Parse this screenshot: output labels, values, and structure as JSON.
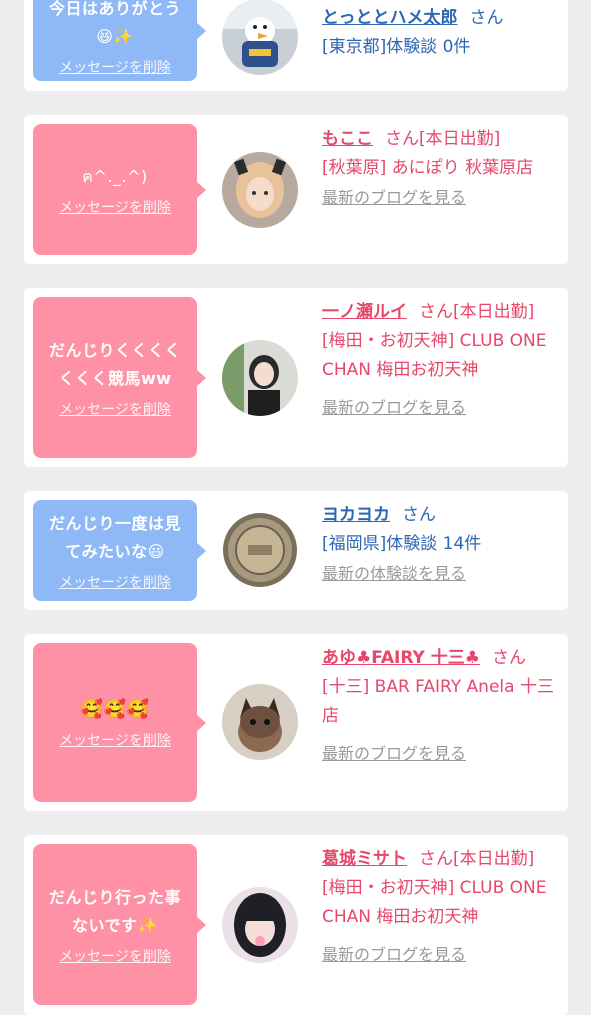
{
  "cards": [
    {
      "message": "今日はありがとう😆✨",
      "delete_label": "メッセージを削除",
      "name": "とっととハメ太郎",
      "honorific": "さん",
      "subtitle": "[東京都]体験談 0件",
      "link": ""
    },
    {
      "message": "ฅ^._.^)",
      "delete_label": "メッセージを削除",
      "name": "もここ",
      "honorific": "さん[本日出勤]",
      "subtitle": "[秋葉原] あにぽり 秋葉原店",
      "link": "最新のブログを見る"
    },
    {
      "message": "だんじりくくくくくくく競馬ww",
      "delete_label": "メッセージを削除",
      "name": "一ノ瀬ルイ",
      "honorific": "さん[本日出勤]",
      "subtitle": "[梅田・お初天神] CLUB ONE CHAN 梅田お初天神",
      "link": "最新のブログを見る"
    },
    {
      "message": "だんじり一度は見てみたいな😃",
      "delete_label": "メッセージを削除",
      "name": "ヨカヨカ",
      "honorific": "さん",
      "subtitle": "[福岡県]体験談 14件",
      "link": "最新の体験談を見る"
    },
    {
      "message": "🥰🥰🥰",
      "delete_label": "メッセージを削除",
      "name": "あゆ♣FAIRY 十三♣",
      "honorific": "さん",
      "subtitle": "[十三] BAR FAIRY Anela 十三店",
      "link": "最新のブログを見る"
    },
    {
      "message": "だんじり行った事ないです✨",
      "delete_label": "メッセージを削除",
      "name": "葛城ミサト",
      "honorific": "さん[本日出勤]",
      "subtitle": "[梅田・お初天神] CLUB ONE CHAN 梅田お初天神",
      "link": "最新のブログを見る"
    }
  ]
}
